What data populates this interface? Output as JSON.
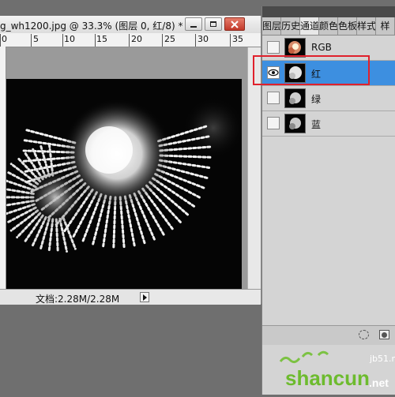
{
  "document": {
    "title": "g_wh1200.jpg @ 33.3% (图层 0, 红/8) *",
    "ruler_labels": [
      "0",
      "5",
      "10",
      "15",
      "20",
      "25",
      "30",
      "35"
    ],
    "status_text": "文档:2.28M/2.28M"
  },
  "panel": {
    "tabs": [
      {
        "label": "图层",
        "active": false
      },
      {
        "label": "历史",
        "active": false
      },
      {
        "label": "通道",
        "active": true
      },
      {
        "label": "颜色",
        "active": false
      },
      {
        "label": "色板",
        "active": false
      },
      {
        "label": "样式",
        "active": false
      },
      {
        "label": "样",
        "active": false
      }
    ],
    "channels": [
      {
        "label": "RGB",
        "visible": false,
        "selected": false,
        "highlighted": false
      },
      {
        "label": "红",
        "visible": true,
        "selected": true,
        "highlighted": true
      },
      {
        "label": "绿",
        "visible": false,
        "selected": false,
        "highlighted": false
      },
      {
        "label": "蓝",
        "visible": false,
        "selected": false,
        "highlighted": false
      }
    ]
  },
  "watermark": {
    "brand": "shancun",
    "suffix": ".net",
    "site": "jb51.net"
  },
  "colors": {
    "selection": "#3d8fe0",
    "highlight": "#e0212c",
    "close_button": "#c2392a"
  }
}
